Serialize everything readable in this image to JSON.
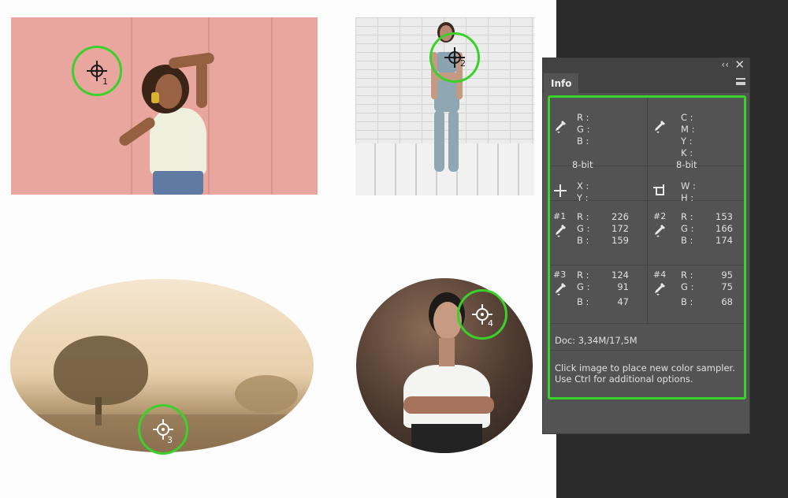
{
  "samplers_on_canvas": [
    {
      "number": "1"
    },
    {
      "number": "2"
    },
    {
      "number": "3"
    },
    {
      "number": "4"
    }
  ],
  "panel": {
    "tab_label": "Info",
    "collapse_glyph": "‹‹",
    "close_glyph": "✕",
    "rgb_block": {
      "r_label": "R :",
      "g_label": "G :",
      "b_label": "B :",
      "bit_depth": "8-bit"
    },
    "cmyk_block": {
      "c_label": "C :",
      "m_label": "M :",
      "y_label": "Y :",
      "k_label": "K :",
      "bit_depth": "8-bit"
    },
    "xy_block": {
      "x_label": "X :",
      "y_label": "Y :"
    },
    "wh_block": {
      "w_label": "W :",
      "h_label": "H :"
    },
    "samplers": [
      {
        "id": "#1",
        "r_label": "R :",
        "g_label": "G :",
        "b_label": "B :",
        "r": "226",
        "g": "172",
        "b": "159"
      },
      {
        "id": "#2",
        "r_label": "R :",
        "g_label": "G :",
        "b_label": "B :",
        "r": "153",
        "g": "166",
        "b": "174"
      },
      {
        "id": "#3",
        "r_label": "R :",
        "g_label": "G :",
        "b_label": "B :",
        "r": "124",
        "g": "91",
        "b": "47"
      },
      {
        "id": "#4",
        "r_label": "R :",
        "g_label": "G :",
        "b_label": "B :",
        "r": "95",
        "g": "75",
        "b": "68"
      }
    ],
    "doc_size": "Doc: 3,34M/17,5M",
    "hint_line1": "Click image to place new color sampler.",
    "hint_line2": "Use Ctrl for additional options."
  },
  "colors": {
    "highlight": "#3ad12a",
    "panel_bg": "#535353",
    "app_bg": "#2a2a2a"
  },
  "icons": [
    "eyedropper-icon",
    "crosshair-icon",
    "selection-size-icon",
    "color-sampler-target-icon",
    "panel-menu-icon",
    "close-icon",
    "collapse-icon"
  ]
}
